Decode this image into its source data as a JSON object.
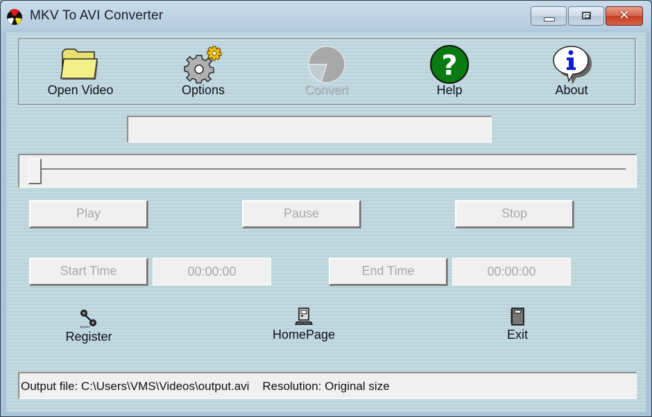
{
  "window": {
    "title": "MKV To AVI Converter",
    "app_icon": "radiation-icon",
    "controls": {
      "minimize": "minimize-icon",
      "maximize": "maximize-icon",
      "close": "close-icon"
    }
  },
  "toolbar": {
    "items": [
      {
        "label": "Open Video",
        "icon": "folder-icon",
        "enabled": true
      },
      {
        "label": "Options",
        "icon": "gears-icon",
        "enabled": true
      },
      {
        "label": "Convert",
        "icon": "pie-chart-icon",
        "enabled": false
      },
      {
        "label": "Help",
        "icon": "question-mark-icon",
        "enabled": true
      },
      {
        "label": "About",
        "icon": "info-bubble-icon",
        "enabled": true
      }
    ]
  },
  "filename_field": {
    "value": ""
  },
  "seek_slider": {
    "position_percent": 0
  },
  "playback": {
    "play": "Play",
    "pause": "Pause",
    "stop": "Stop"
  },
  "trim": {
    "start_label": "Start Time",
    "start_value": "00:00:00",
    "end_label": "End Time",
    "end_value": "00:00:00"
  },
  "links": {
    "register": {
      "label": "Register",
      "icon": "key-icon"
    },
    "homepage": {
      "label": "HomePage",
      "icon": "computer-icon"
    },
    "exit": {
      "label": "Exit",
      "icon": "book-icon"
    }
  },
  "status": {
    "output_file_label": "Output file:",
    "output_file": "C:\\Users\\VMS\\Videos\\output.avi",
    "resolution_label": "Resolution:",
    "resolution": "Original size",
    "text": "Output file: C:\\Users\\VMS\\Videos\\output.avi    Resolution: Original size"
  },
  "colors": {
    "client_bg": "#bdd6dc",
    "disabled_text": "#a8a8a8",
    "help_green": "#0a7a12",
    "about_blue": "#1020d0",
    "close_red": "#c33d21"
  }
}
